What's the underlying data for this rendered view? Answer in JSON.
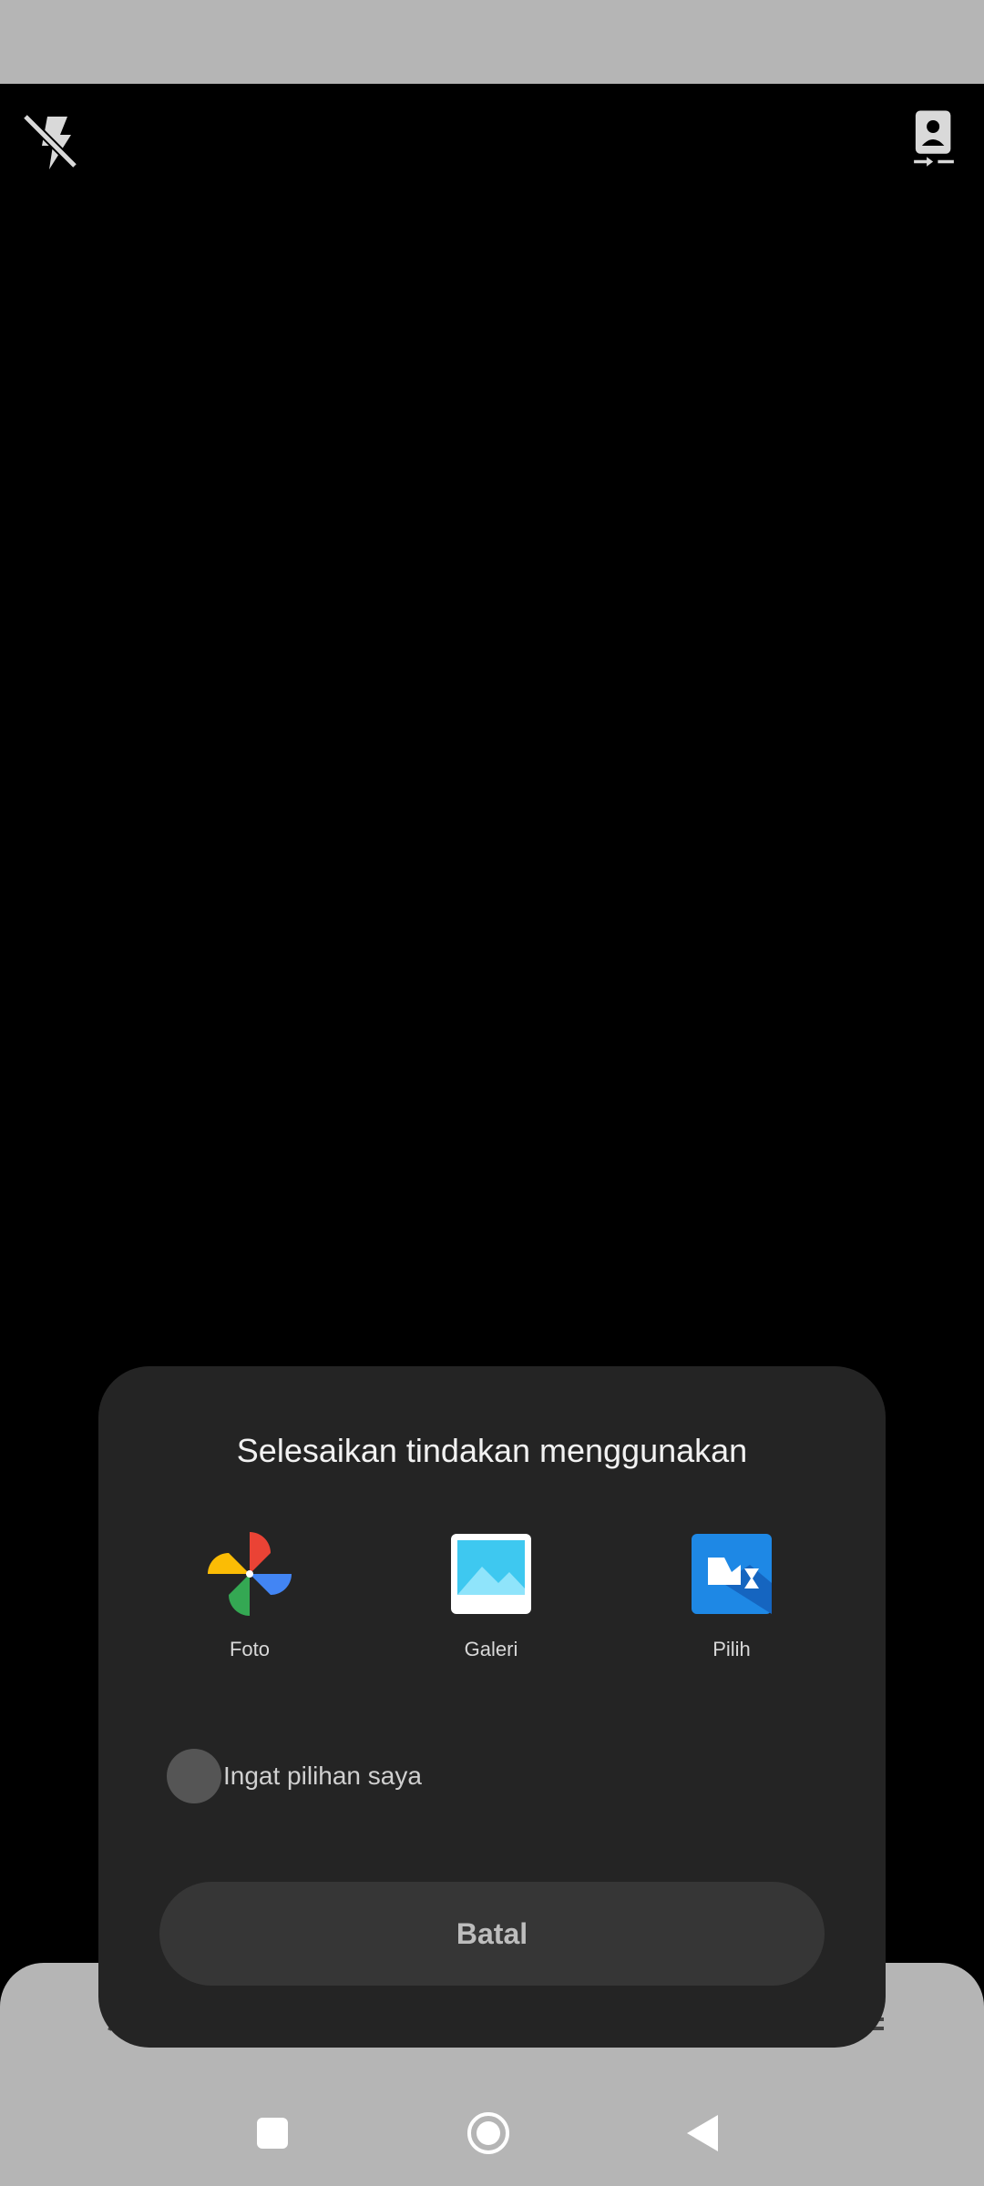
{
  "camera": {
    "flash_icon": "flash-off-icon",
    "switch_icon": "switch-camera-icon"
  },
  "dialog": {
    "title": "Selesaikan tindakan menggunakan",
    "apps": [
      {
        "label": "Foto",
        "icon": "google-photos-icon"
      },
      {
        "label": "Galeri",
        "icon": "gallery-icon"
      },
      {
        "label": "Pilih",
        "icon": "selector-icon"
      }
    ],
    "remember_label": "Ingat pilihan saya",
    "cancel_label": "Batal"
  },
  "nav": {
    "recents_icon": "square-icon",
    "home_icon": "home-circle-icon",
    "back_icon": "back-triangle-icon"
  },
  "colors": {
    "status_bar": "#b5b5b5",
    "dialog_bg": "#242424",
    "cancel_bg": "#363636",
    "accent_blue": "#1e88e5"
  }
}
